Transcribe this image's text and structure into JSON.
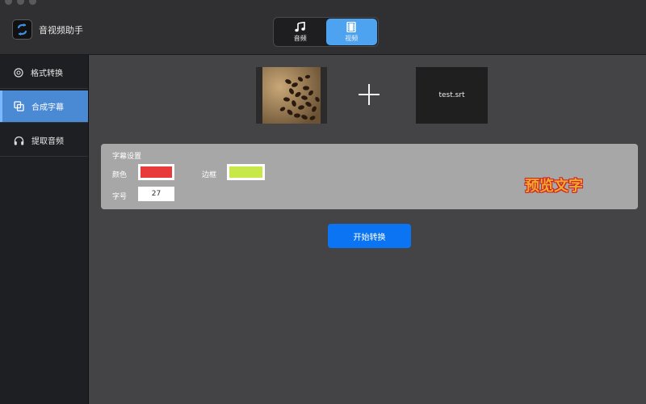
{
  "app": {
    "title": "音视频助手",
    "logo_icon": "swap-arrows-icon"
  },
  "mode_switch": {
    "items": [
      {
        "label": "音频",
        "icon": "music-note-icon",
        "active": false
      },
      {
        "label": "视频",
        "icon": "film-icon",
        "active": true
      }
    ]
  },
  "sidebar": {
    "items": [
      {
        "label": "格式转换",
        "icon": "convert-icon",
        "active": false
      },
      {
        "label": "合成字幕",
        "icon": "layers-icon",
        "active": true
      },
      {
        "label": "提取音频",
        "icon": "headphones-icon",
        "active": false
      }
    ]
  },
  "main": {
    "subtitle_file": "test.srt",
    "settings": {
      "title": "字幕设置",
      "color_label": "颜色",
      "color_value": "#e83a3a",
      "border_label": "边框",
      "border_value": "#c8e84a",
      "size_label": "字号",
      "size_value": "27",
      "preview_text": "预览文字"
    },
    "start_label": "开始转换"
  },
  "colors": {
    "accent": "#4ea3f0",
    "sidebar_active": "#4a89d3",
    "start_button": "#0a74f2"
  }
}
